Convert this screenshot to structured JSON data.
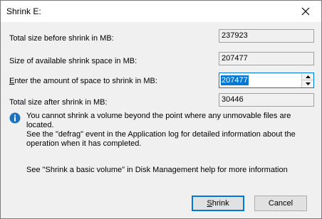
{
  "window": {
    "title": "Shrink E:"
  },
  "form": {
    "total_before_label": "Total size before shrink in MB:",
    "total_before_value": "237923",
    "available_label": "Size of available shrink space in MB:",
    "available_value": "207477",
    "enter_label_prefix": "E",
    "enter_label_rest": "nter the amount of space to shrink in MB:",
    "enter_value": "207477",
    "total_after_label": "Total size after shrink in MB:",
    "total_after_value": "30446"
  },
  "info": {
    "icon": "info-icon",
    "line1": "You cannot shrink a volume beyond the point where any unmovable files are located.",
    "line2": "See the \"defrag\" event in the Application log for detailed information about the",
    "line3": "operation when it has completed."
  },
  "help": {
    "text": "See \"Shrink a basic volume\" in Disk Management help for more information"
  },
  "buttons": {
    "shrink_prefix": "S",
    "shrink_rest": "hrink",
    "cancel_label": "Cancel"
  },
  "colors": {
    "accent": "#0078d7",
    "info_icon": "#1e73be"
  }
}
